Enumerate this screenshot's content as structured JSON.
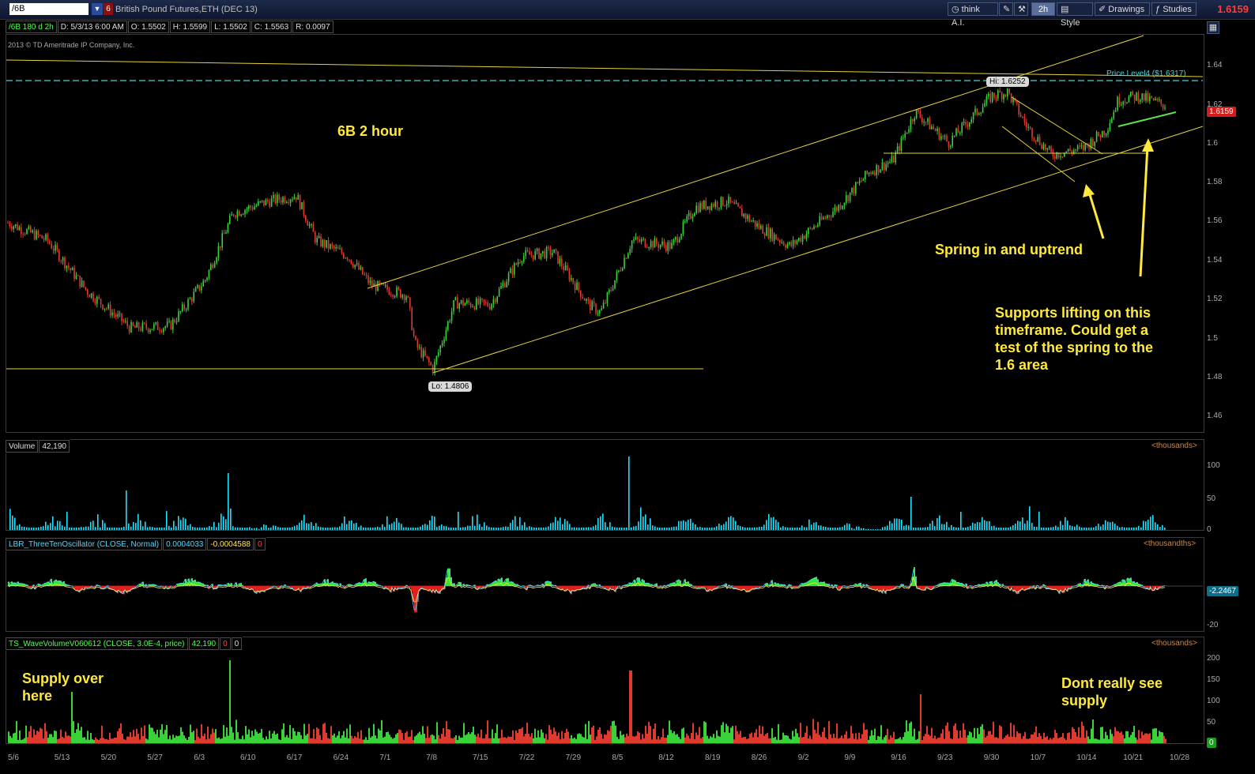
{
  "toolbar": {
    "symbol": "/6B",
    "symbol_number": "6",
    "description": "British Pound Futures,ETH (DEC 13)",
    "think_label": "think A.I.",
    "interval": "2h",
    "style_label": "Style",
    "drawings_label": "Drawings",
    "studies_label": "Studies",
    "last_price": "1.6159"
  },
  "price_header": {
    "symbol_period": "/6B 180 d 2h",
    "date": "D: 5/3/13 6:00 AM",
    "open": "O: 1.5502",
    "high": "H: 1.5599",
    "low": "L: 1.5502",
    "close": "C: 1.5563",
    "range": "R: 0.0097"
  },
  "copyright": "2013 © TD Ameritrade IP Company, Inc.",
  "price_axis": [
    "1.64",
    "1.62",
    "1.6",
    "1.58",
    "1.56",
    "1.54",
    "1.52",
    "1.5",
    "1.48",
    "1.46"
  ],
  "price_tag": "1.6159",
  "hi_label": "Hi: 1.6252",
  "lo_label": "Lo: 1.4806",
  "price_level_label": "Price Level4 ($1.6317)",
  "notes": {
    "title": "6B 2 hour",
    "spring": "Spring in and uptrend",
    "supports": [
      "Supports lifting on this",
      "timeframe.  Could get a",
      "test of the spring to the",
      "1.6 area"
    ],
    "supply_left": [
      "Supply over",
      "here"
    ],
    "supply_right": [
      "Dont really see",
      "supply"
    ]
  },
  "volume_panel": {
    "label": "Volume",
    "value": "42,190",
    "units": "<thousands>",
    "axis": [
      "100",
      "50",
      "0"
    ]
  },
  "oscillator_panel": {
    "label": "LBR_ThreeTenOscillator (CLOSE, Normal)",
    "value1": "0.0004033",
    "value2": "-0.0004588",
    "value3": "0",
    "units": "<thousandths>",
    "axis_low": "-20",
    "tag": "-2.2467"
  },
  "wave_panel": {
    "label": "TS_WaveVolumeV060612 (CLOSE, 3.0E-4, price)",
    "value1": "42,190",
    "value2": "0",
    "value3": "0",
    "units": "<thousands>",
    "axis": [
      "200",
      "150",
      "100",
      "50"
    ],
    "tag": "0"
  },
  "dates": [
    "5/6",
    "5/13",
    "5/20",
    "5/27",
    "6/3",
    "6/10",
    "6/17",
    "6/24",
    "7/1",
    "7/8",
    "7/15",
    "7/22",
    "7/29",
    "8/5",
    "8/12",
    "8/19",
    "8/26",
    "9/2",
    "9/9",
    "9/16",
    "9/23",
    "9/30",
    "10/7",
    "10/14",
    "10/21",
    "10/28"
  ],
  "colors": {
    "up": "#39d339",
    "down": "#e03a2e",
    "trendline": "#e6d23a",
    "volume": "#1ee0ff",
    "level": "#3fd7e0"
  }
}
